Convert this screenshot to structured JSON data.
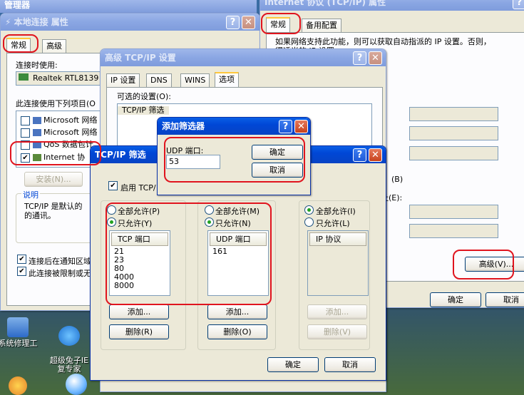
{
  "desktop": {
    "icons": [
      {
        "label": "系统修理工"
      },
      {
        "label": "超级兔子IE\n复专家"
      }
    ]
  },
  "win_local": {
    "title": "本地连接 属性",
    "tabs": [
      "常规",
      "高级"
    ],
    "connect_using_label": "连接时使用:",
    "adapter": "Realtek RTL8139",
    "items_label": "此连接使用下列项目(O",
    "items": [
      {
        "label": "Microsoft 网络",
        "checked": false
      },
      {
        "label": "Microsoft 网络",
        "checked": false
      },
      {
        "label": "QoS 数据包计",
        "checked": false
      },
      {
        "label": "Internet 协",
        "checked": true
      }
    ],
    "install_btn": "安装(N)...",
    "desc_title": "说明",
    "desc_text": "TCP/IP 是默认的\n的通讯。",
    "opt1": "连接后在通知区域",
    "opt2": "此连接被限制或无"
  },
  "win_tcpip_props": {
    "title": "Internet 协议 (TCP/IP) 属性",
    "tabs": [
      "常规",
      "备用配置"
    ],
    "intro": "如果网络支持此功能，则可以获取自动指派的 IP 设置。否则，\n得适当的 IP 设置。",
    "radio_b": "(B)",
    "label_e": "址(E):",
    "advanced_btn": "高级(V)...",
    "ok_btn": "确定",
    "cancel_btn": "取消"
  },
  "win_advanced": {
    "title": "高级 TCP/IP 设置",
    "tabs": [
      "IP 设置",
      "DNS",
      "WINS",
      "选项"
    ],
    "optional_label": "可选的设置(O):",
    "optional_item": "TCP/IP 筛选"
  },
  "win_filter": {
    "title": "TCP/IP 筛选",
    "enable_label": "启用 TCP/",
    "tcp": {
      "allow_all": "全部允许(P)",
      "allow_only": "只允许(Y)",
      "header": "TCP 端口",
      "ports": [
        "21",
        "23",
        "80",
        "4000",
        "8000"
      ],
      "add": "添加...",
      "remove": "删除(R)"
    },
    "udp": {
      "allow_all": "全部允许(M)",
      "allow_only": "只允许(N)",
      "header": "UDP 端口",
      "ports": [
        "161"
      ],
      "add": "添加...",
      "remove": "删除(O)"
    },
    "ip": {
      "allow_all": "全部允许(I)",
      "allow_only": "只允许(L)",
      "header": "IP 协议",
      "add": "添加...",
      "remove": "删除(V)"
    },
    "ok_btn": "确定",
    "cancel_btn": "取消"
  },
  "win_add": {
    "title": "添加筛选器",
    "udp_label": "UDP 端口:",
    "udp_value": "53",
    "ok_btn": "确定",
    "cancel_btn": "取消"
  },
  "top_left_fragment": "管理器",
  "colors": {
    "highlight": "#e0141e",
    "xp_title": "#0a5fe6"
  }
}
